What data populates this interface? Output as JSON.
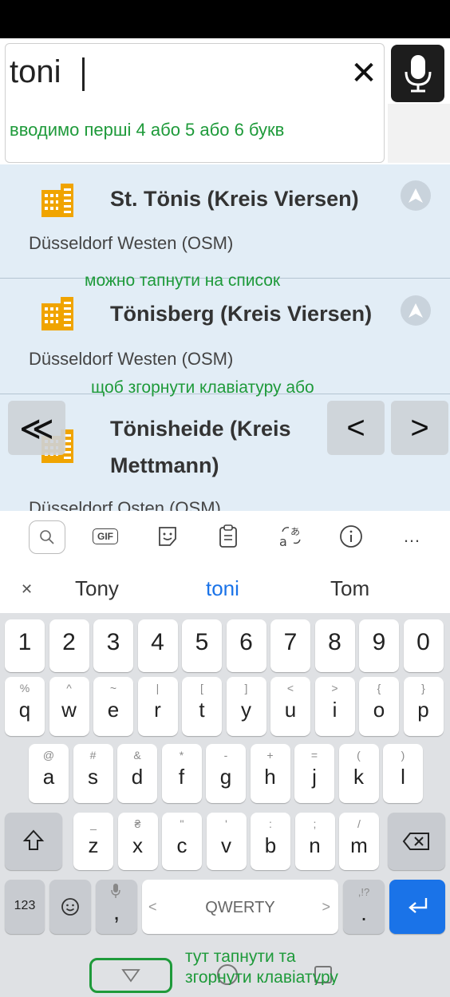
{
  "search": {
    "query": "toni",
    "clear_glyph": "✕"
  },
  "hints": {
    "first_letters": "вводимо перші 4 або 5 або 6 букв",
    "tap_list": "можно тапнути на список",
    "collapse_keyboard_or": "щоб згорнути клавіатуру або",
    "tap_here_line1": "тут тапнути та",
    "tap_here_line2": "згорнути клавіатуру"
  },
  "results": [
    {
      "title": "St. Tönis (Kreis Viersen)",
      "subtitle": "Düsseldorf Westen (OSM)"
    },
    {
      "title": "Tönisberg (Kreis Viersen)",
      "subtitle": "Düsseldorf Westen (OSM)"
    },
    {
      "title_line1": "Tönisheide (Kreis",
      "title_line2": "Mettmann)",
      "subtitle": "Düsseldorf Osten (OSM)"
    }
  ],
  "overlay": {
    "first_glyph": "≪",
    "prev_glyph": "<",
    "next_glyph": ">"
  },
  "keyboard": {
    "toolbar": {
      "gif_label": "GIF",
      "more_glyph": "…"
    },
    "suggestions": {
      "close_glyph": "✕",
      "items": [
        "Tony",
        "toni",
        "Tom"
      ],
      "highlight_color": "#1a73e8"
    },
    "number_row": [
      "1",
      "2",
      "3",
      "4",
      "5",
      "6",
      "7",
      "8",
      "9",
      "0"
    ],
    "row1": [
      {
        "main": "q",
        "sec": "%"
      },
      {
        "main": "w",
        "sec": "^"
      },
      {
        "main": "e",
        "sec": "~"
      },
      {
        "main": "r",
        "sec": "|"
      },
      {
        "main": "t",
        "sec": "["
      },
      {
        "main": "y",
        "sec": "]"
      },
      {
        "main": "u",
        "sec": "<"
      },
      {
        "main": "i",
        "sec": ">"
      },
      {
        "main": "o",
        "sec": "{"
      },
      {
        "main": "p",
        "sec": "}"
      }
    ],
    "row2": [
      {
        "main": "a",
        "sec": "@"
      },
      {
        "main": "s",
        "sec": "#"
      },
      {
        "main": "d",
        "sec": "&"
      },
      {
        "main": "f",
        "sec": "*"
      },
      {
        "main": "g",
        "sec": "-"
      },
      {
        "main": "h",
        "sec": "+"
      },
      {
        "main": "j",
        "sec": "="
      },
      {
        "main": "k",
        "sec": "("
      },
      {
        "main": "l",
        "sec": ")"
      }
    ],
    "row3": [
      {
        "main": "z",
        "sec": "_"
      },
      {
        "main": "x",
        "sec": "₴"
      },
      {
        "main": "c",
        "sec": "\""
      },
      {
        "main": "v",
        "sec": "'"
      },
      {
        "main": "b",
        "sec": ":"
      },
      {
        "main": "n",
        "sec": ";"
      },
      {
        "main": "m",
        "sec": "/"
      }
    ],
    "bottom": {
      "num_label": "123",
      "space_label": "QWERTY",
      "space_left": "<",
      "space_right": ">",
      "comma": ",",
      "period": ".",
      "period_sec": ",!?"
    },
    "enter_color": "#1a73e8"
  },
  "colors": {
    "hint": "#1e9a3a",
    "building": "#f0a400",
    "results_bg": "#e2edf6"
  }
}
